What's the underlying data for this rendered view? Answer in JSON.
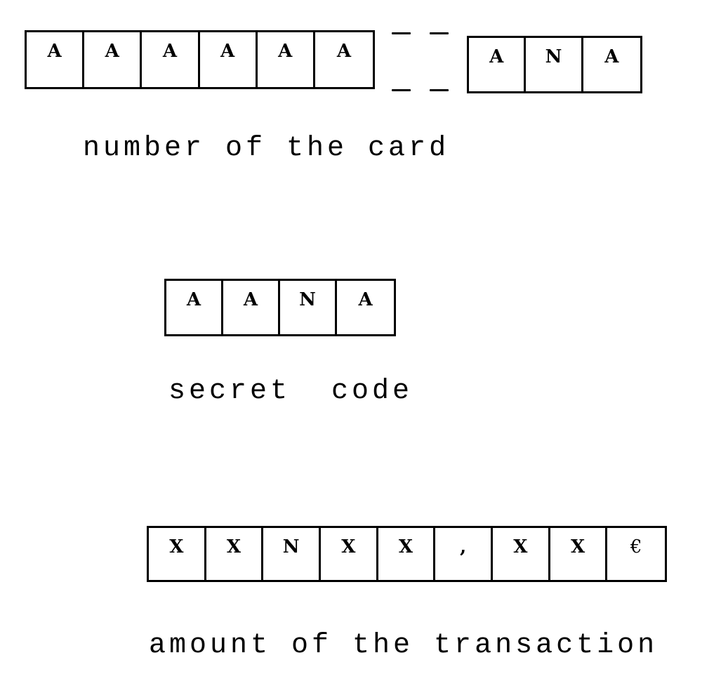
{
  "card_number": {
    "label": "number of the card",
    "leading_cells": [
      "A",
      "A",
      "A",
      "A",
      "A",
      "A"
    ],
    "ellipsis": "dashed-gap",
    "trailing_cells": [
      "A",
      "N",
      "A"
    ]
  },
  "secret_code": {
    "label": "secret  code",
    "cells": [
      "A",
      "A",
      "N",
      "A"
    ]
  },
  "transaction_amount": {
    "label": "amount of the transaction",
    "cells": [
      "X",
      "X",
      "N",
      "X",
      "X",
      ",",
      "X",
      "X",
      "€"
    ]
  }
}
